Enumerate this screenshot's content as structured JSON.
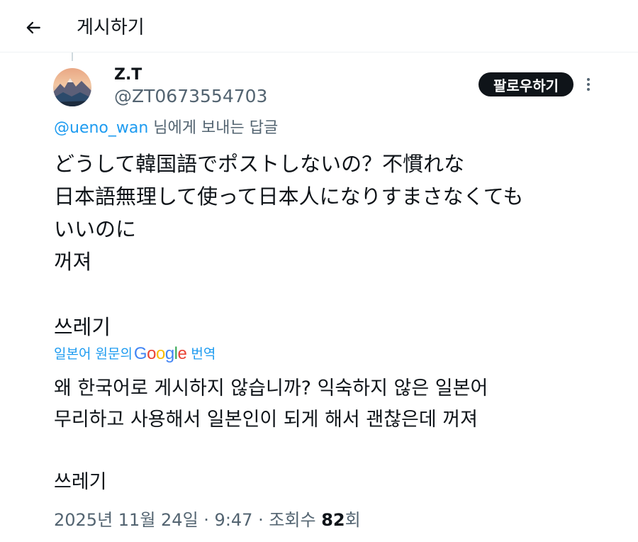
{
  "header": {
    "title": "게시하기"
  },
  "author": {
    "display_name": "Z.T",
    "handle": "@ZT0673554703"
  },
  "follow_button": {
    "label": "팔로우하기"
  },
  "reply": {
    "mention": "@ueno_wan",
    "suffix": " 님에게 보내는 답글"
  },
  "tweet": {
    "text": "どうして韓国語でポストしないの？不慣れな\n日本語無理して使って日本人になりすまさなくても\nいいのに\n꺼져\n\n쓰레기"
  },
  "translation": {
    "prefix": "일본어 원문의",
    "suffix": "번역",
    "google": [
      "G",
      "o",
      "o",
      "g",
      "l",
      "e"
    ],
    "text": "왜 한국어로 게시하지 않습니까? 익숙하지 않은 일본어\n무리하고 사용해서 일본인이 되게 해서 괜찮은데 꺼져\n\n쓰레기"
  },
  "meta": {
    "date": "2025년 11월 24일",
    "sep1": " · ",
    "time": "9:47",
    "sep2": " · ",
    "views_label": "조회수 ",
    "views_count": "82",
    "views_unit": "회"
  },
  "colors": {
    "accent": "#1d9bf0",
    "secondary_text": "#536471",
    "primary_text": "#0f1419",
    "google_blue": "#4285F4",
    "google_red": "#EA4335",
    "google_yellow": "#FBBC05",
    "google_green": "#34A853"
  },
  "icons": {
    "back": "arrow-left-icon",
    "more": "more-vertical-icon"
  }
}
